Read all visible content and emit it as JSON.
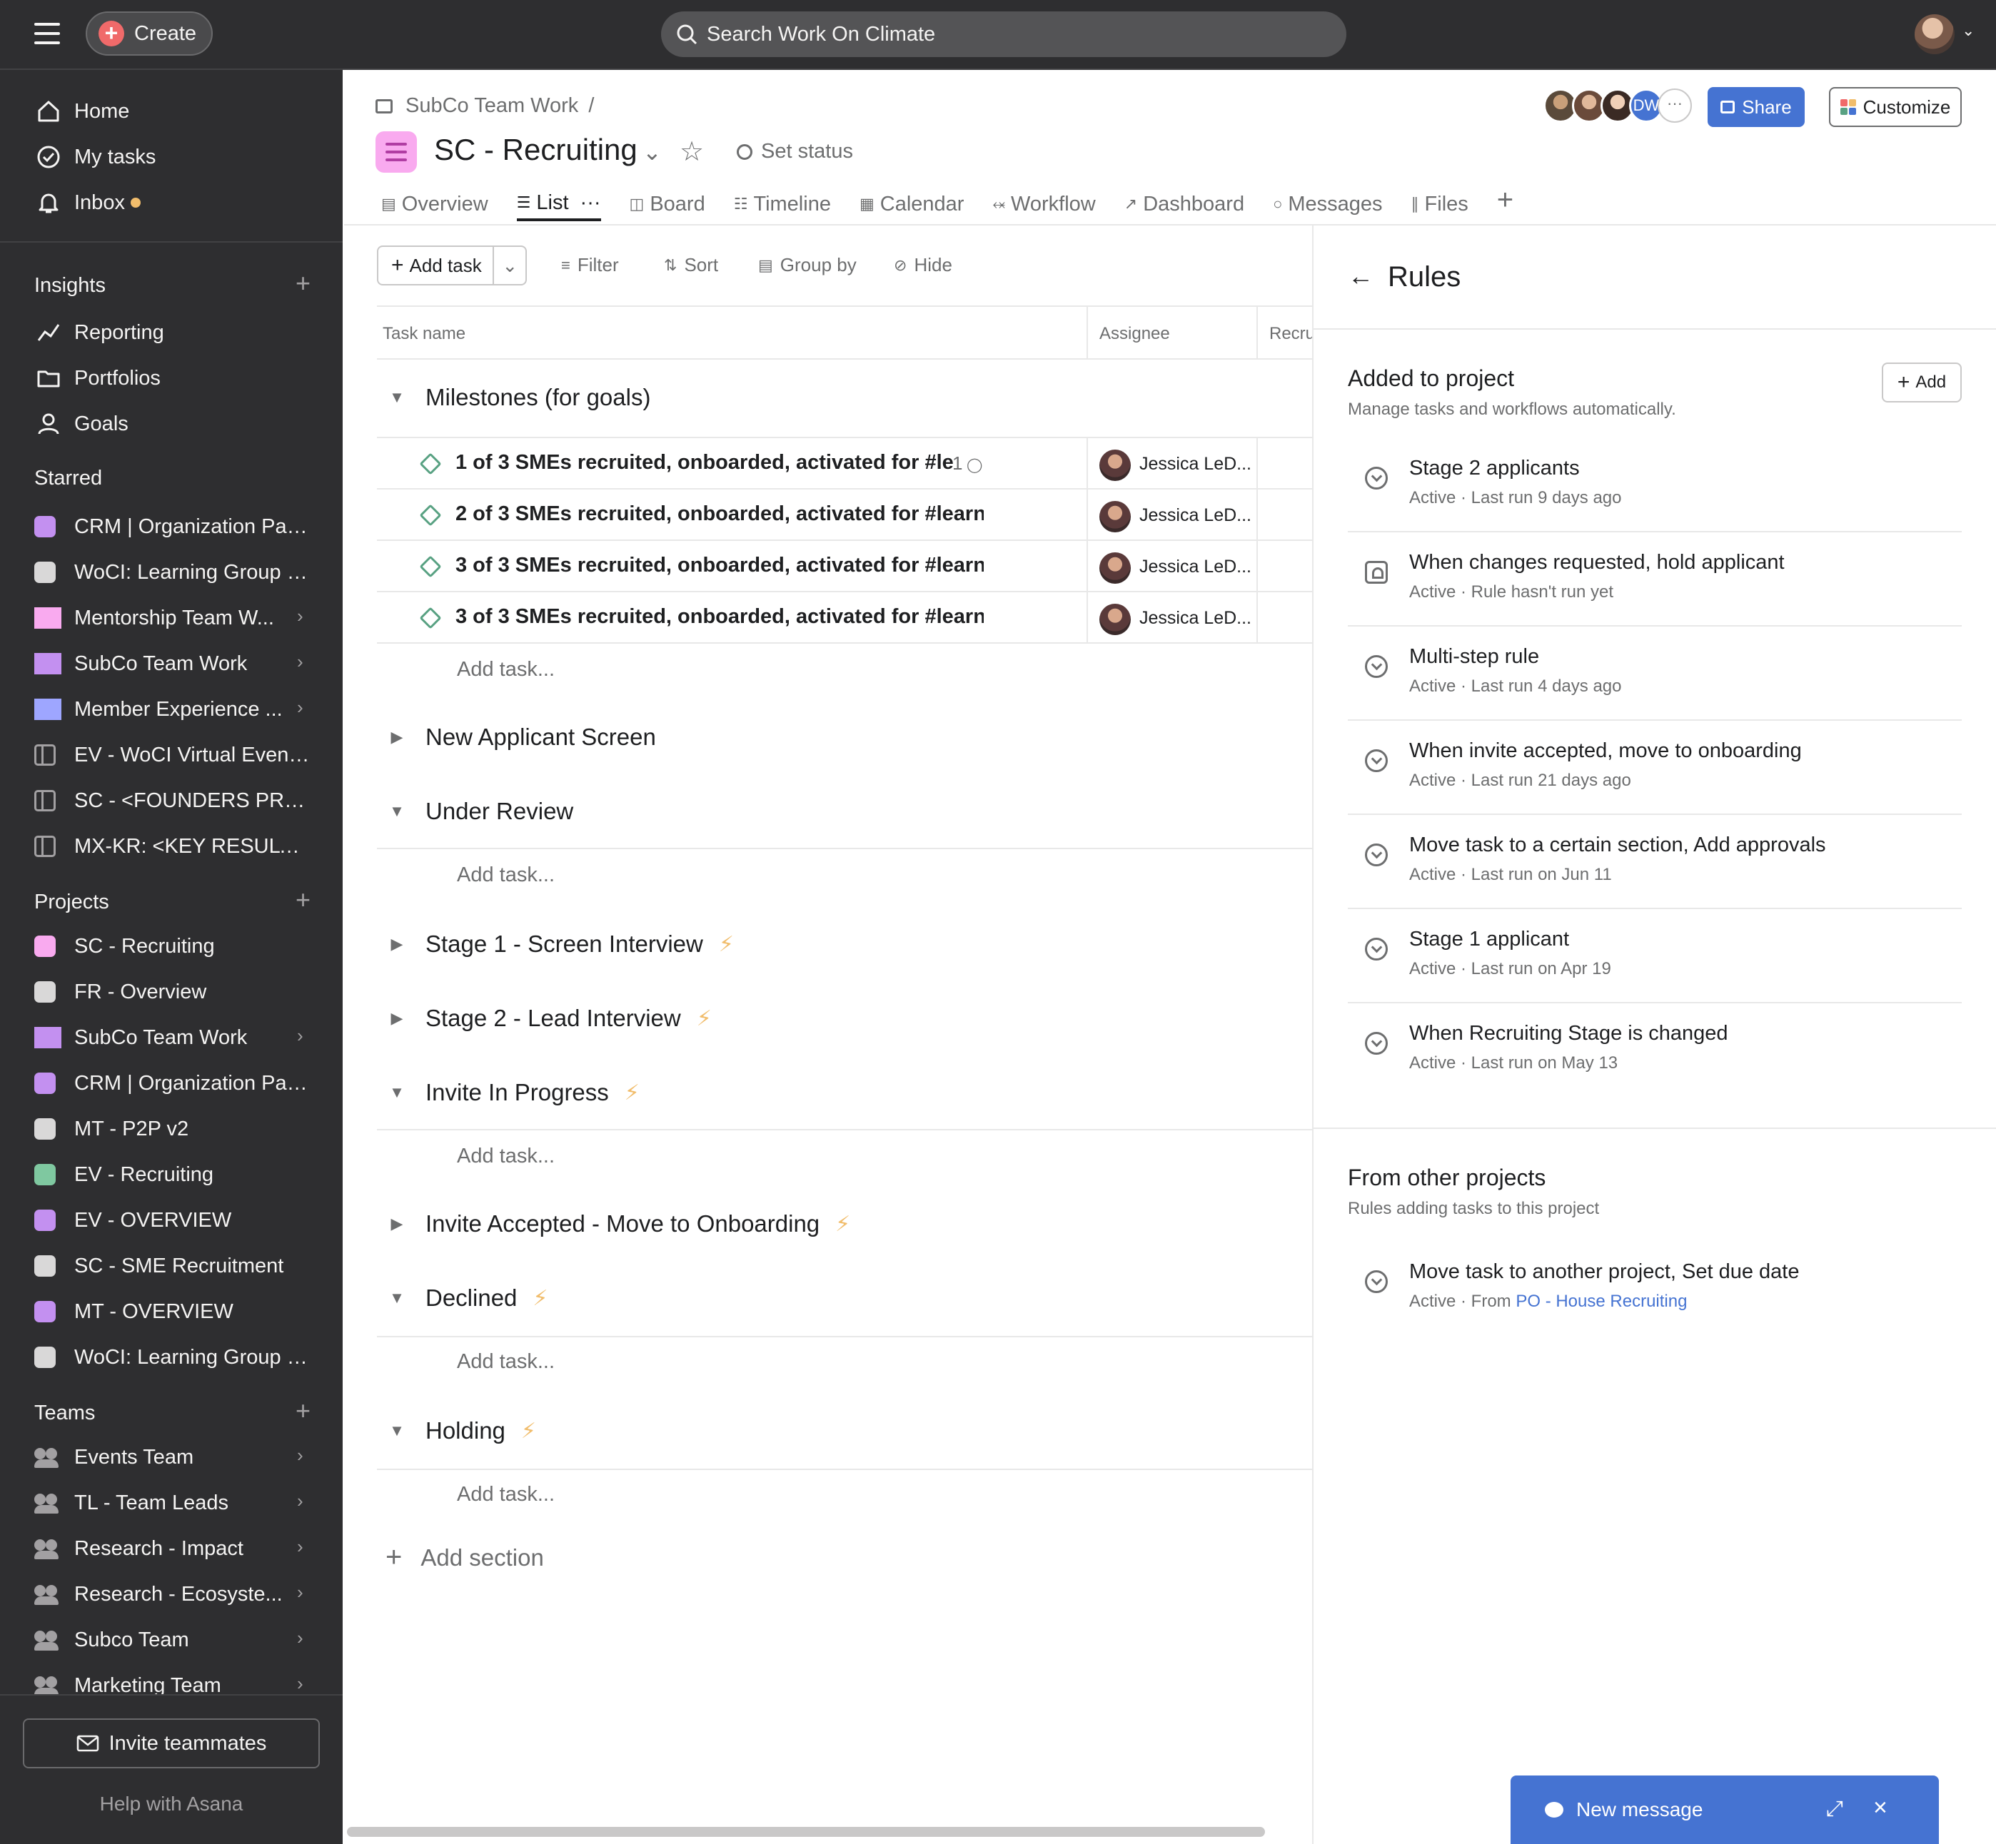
{
  "topbar": {
    "create_label": "Create",
    "search_placeholder": "Search Work On Climate"
  },
  "sidebar": {
    "nav": [
      {
        "label": "Home",
        "icon": "home-icon"
      },
      {
        "label": "My tasks",
        "icon": "check-circle-icon"
      },
      {
        "label": "Inbox",
        "icon": "bell-icon"
      }
    ],
    "insights_title": "Insights",
    "insights": [
      {
        "label": "Reporting",
        "icon": "line-chart-icon"
      },
      {
        "label": "Portfolios",
        "icon": "folder-icon"
      },
      {
        "label": "Goals",
        "icon": "person-icon"
      }
    ],
    "starred_title": "Starred",
    "starred": [
      {
        "label": "CRM | Organization Part...",
        "kind": "square",
        "color": "#c390f0",
        "chevron": false
      },
      {
        "label": "WoCI: Learning Group - ...",
        "kind": "square",
        "color": "#d9d8d8",
        "chevron": false
      },
      {
        "label": "Mentorship Team W...",
        "kind": "folder",
        "color": "#f9aaef",
        "chevron": true
      },
      {
        "label": "SubCo Team Work",
        "kind": "folder",
        "color": "#c390f0",
        "chevron": true
      },
      {
        "label": "Member Experience ...",
        "kind": "folder",
        "color": "#9ea6ff",
        "chevron": true
      },
      {
        "label": "EV - WoCI Virtual Event ...",
        "kind": "board",
        "color": "#a2a0a2",
        "chevron": false
      },
      {
        "label": "SC - <FOUNDERS PROG...",
        "kind": "board",
        "color": "#a2a0a2",
        "chevron": false
      },
      {
        "label": "MX-KR: <KEY RESULT S...",
        "kind": "board",
        "color": "#a2a0a2",
        "chevron": false
      }
    ],
    "projects_title": "Projects",
    "projects": [
      {
        "label": "SC - Recruiting",
        "kind": "square",
        "color": "#f9aaef",
        "chevron": false
      },
      {
        "label": "FR - Overview",
        "kind": "square",
        "color": "#d9d8d8",
        "chevron": false
      },
      {
        "label": "SubCo Team Work",
        "kind": "folder",
        "color": "#c390f0",
        "chevron": true
      },
      {
        "label": "CRM | Organization Part...",
        "kind": "square",
        "color": "#c390f0",
        "chevron": false
      },
      {
        "label": "MT - P2P v2",
        "kind": "square",
        "color": "#d9d8d8",
        "chevron": false
      },
      {
        "label": "EV - Recruiting",
        "kind": "square",
        "color": "#7fc8a0",
        "chevron": false
      },
      {
        "label": "EV - OVERVIEW",
        "kind": "square",
        "color": "#c390f0",
        "chevron": false
      },
      {
        "label": "SC - SME Recruitment",
        "kind": "square",
        "color": "#d9d8d8",
        "chevron": false
      },
      {
        "label": "MT - OVERVIEW",
        "kind": "square",
        "color": "#c390f0",
        "chevron": false
      },
      {
        "label": "WoCI: Learning Group - ...",
        "kind": "square",
        "color": "#d9d8d8",
        "chevron": false
      }
    ],
    "teams_title": "Teams",
    "teams": [
      {
        "label": "Events Team"
      },
      {
        "label": "TL - Team Leads"
      },
      {
        "label": "Research - Impact"
      },
      {
        "label": "Research - Ecosyste..."
      },
      {
        "label": "Subco Team"
      },
      {
        "label": "Marketing Team"
      }
    ],
    "invite_label": "Invite teammates",
    "help_label": "Help with Asana"
  },
  "project": {
    "breadcrumb": "SubCo Team Work",
    "breadcrumb_sep": "/",
    "title": "SC - Recruiting",
    "set_status": "Set status",
    "member_initials": "DW",
    "more_members": "···",
    "share_label": "Share",
    "customize_label": "Customize",
    "tabs": [
      {
        "label": "Overview",
        "icon": "clipboard-icon",
        "active": false
      },
      {
        "label": "List",
        "icon": "list-icon",
        "active": true
      },
      {
        "label": "Board",
        "icon": "board-icon",
        "active": false
      },
      {
        "label": "Timeline",
        "icon": "timeline-icon",
        "active": false
      },
      {
        "label": "Calendar",
        "icon": "calendar-icon",
        "active": false
      },
      {
        "label": "Workflow",
        "icon": "workflow-icon",
        "active": false
      },
      {
        "label": "Dashboard",
        "icon": "dashboard-icon",
        "active": false
      },
      {
        "label": "Messages",
        "icon": "message-icon",
        "active": false
      },
      {
        "label": "Files",
        "icon": "paperclip-icon",
        "active": false
      }
    ],
    "tab_more": "···"
  },
  "toolbar": {
    "add_task": "Add task",
    "filter": "Filter",
    "sort": "Sort",
    "group_by": "Group by",
    "hide": "Hide"
  },
  "table": {
    "columns": [
      "Task name",
      "Assignee",
      "Recru"
    ],
    "add_task_label": "Add task...",
    "add_section_label": "Add section",
    "sections": [
      {
        "name": "Milestones (for goals)",
        "expanded": true,
        "rule": false
      },
      {
        "name": "New Applicant Screen",
        "expanded": false,
        "rule": false
      },
      {
        "name": "Under Review",
        "expanded": true,
        "rule": false
      },
      {
        "name": "Stage 1 - Screen Interview",
        "expanded": false,
        "rule": true
      },
      {
        "name": "Stage 2 - Lead Interview",
        "expanded": false,
        "rule": true
      },
      {
        "name": "Invite In Progress",
        "expanded": true,
        "rule": true
      },
      {
        "name": "Invite Accepted - Move to Onboarding",
        "expanded": false,
        "rule": true
      },
      {
        "name": "Declined",
        "expanded": true,
        "rule": true
      },
      {
        "name": "Holding",
        "expanded": true,
        "rule": true
      }
    ],
    "tasks": [
      {
        "name": "1 of 3 SMEs recruited, onboarded, activated for #le",
        "comments": "1",
        "assignee": "Jessica LeD..."
      },
      {
        "name": "2 of 3 SMEs recruited, onboarded, activated for #learn·",
        "comments": "",
        "assignee": "Jessica LeD..."
      },
      {
        "name": "3 of 3 SMEs recruited, onboarded, activated for #learn·",
        "comments": "",
        "assignee": "Jessica LeD..."
      },
      {
        "name": "3 of 3 SMEs recruited, onboarded, activated for #learn·",
        "comments": "",
        "assignee": "Jessica LeD..."
      }
    ]
  },
  "rules": {
    "title": "Rules",
    "added_title": "Added to project",
    "added_sub": "Manage tasks and workflows automatically.",
    "add_label": "Add",
    "items": [
      {
        "name": "Stage 2 applicants",
        "meta": "Active · Last run 9 days ago",
        "icon": "rule-icon"
      },
      {
        "name": "When changes requested, hold applicant",
        "meta": "Active · Rule hasn't run yet",
        "icon": "approval-rule-icon"
      },
      {
        "name": "Multi-step rule",
        "meta": "Active · Last run 4 days ago",
        "icon": "rule-icon"
      },
      {
        "name": "When invite accepted, move to onboarding",
        "meta": "Active · Last run 21 days ago",
        "icon": "rule-icon"
      },
      {
        "name": "Move task to a certain section, Add approvals",
        "meta": "Active · Last run on Jun 11",
        "icon": "rule-icon"
      },
      {
        "name": "Stage 1 applicant",
        "meta": "Active · Last run on Apr 19",
        "icon": "rule-icon"
      },
      {
        "name": "When Recruiting Stage is changed",
        "meta": "Active · Last run on May 13",
        "icon": "rule-icon"
      }
    ],
    "other_title": "From other projects",
    "other_sub": "Rules adding tasks to this project",
    "other_items": [
      {
        "name": "Move task to another project, Set due date",
        "meta_prefix": "Active · From ",
        "link": "PO - House Recruiting"
      }
    ]
  },
  "new_message": {
    "label": "New message"
  },
  "colors": {
    "accent": "#4573d2",
    "sidebar_bg": "#2e2e30",
    "rule_bolt": "#f1bd6c",
    "milestone": "#58a182",
    "create_plus": "#f06a6a"
  }
}
